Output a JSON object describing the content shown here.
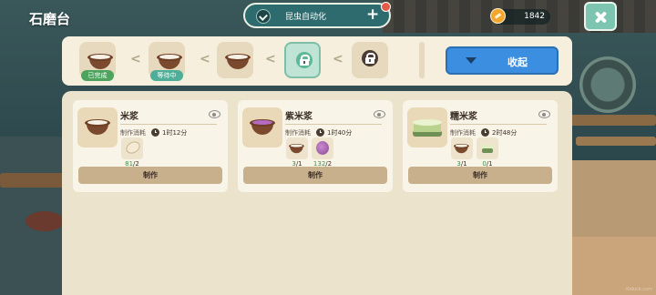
{
  "window": {
    "title": "石磨台"
  },
  "automation": {
    "label": "昆虫自动化",
    "plus": "+"
  },
  "currency": {
    "amount": "1842"
  },
  "queue": {
    "slots": [
      {
        "state": "done",
        "badge": "已完成",
        "icon": "bowl-icon"
      },
      {
        "state": "waiting",
        "badge": "等待中",
        "icon": "bowl-icon"
      },
      {
        "state": "queued",
        "badge": "",
        "icon": "bowl-icon"
      },
      {
        "state": "unlockable",
        "badge": "",
        "icon": "lock-icon"
      },
      {
        "state": "locked",
        "badge": "",
        "icon": "lock-icon"
      }
    ],
    "separator": "<",
    "collapse_label": "收起"
  },
  "recipes": [
    {
      "name": "米浆",
      "cost_label": "制作消耗",
      "time": "1时12分",
      "ingredients": [
        {
          "icon": "rice-grain-icon",
          "have": "81",
          "need": "/2"
        }
      ],
      "button": "制作"
    },
    {
      "name": "紫米浆",
      "cost_label": "制作消耗",
      "time": "1时40分",
      "ingredients": [
        {
          "icon": "rice-paste-icon",
          "have": "3",
          "need": "/1"
        },
        {
          "icon": "purple-taro-icon",
          "have": "132",
          "need": "/2"
        }
      ],
      "button": "制作"
    },
    {
      "name": "糯米浆",
      "cost_label": "制作消耗",
      "time": "2时48分",
      "ingredients": [
        {
          "icon": "rice-paste-icon",
          "have": "3",
          "need": "/1"
        },
        {
          "icon": "glutinous-leaf-icon",
          "have": "0",
          "need": "/1"
        }
      ],
      "button": "制作"
    }
  ],
  "watermark": "Kiduck.com",
  "colors": {
    "accent_blue": "#3b8ee0",
    "ok_green": "#3c8f4a",
    "done_badge": "#4ea45e",
    "wait_badge": "#4fae98",
    "panel_bg": "#ece3cc"
  }
}
